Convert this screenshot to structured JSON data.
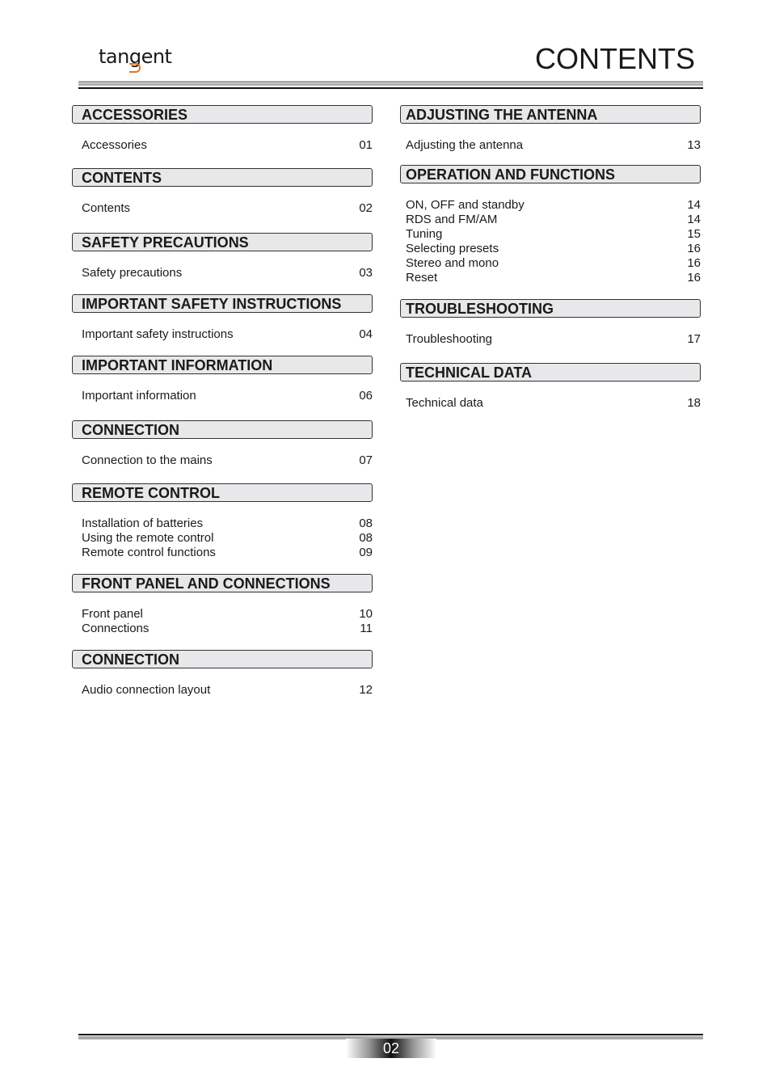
{
  "header": {
    "brand": "tangent",
    "title": "CONTENTS"
  },
  "footer": {
    "page_number": "02"
  },
  "left_column": [
    {
      "heading": "ACCESSORIES",
      "items": [
        {
          "label": "Accessories",
          "page": "01"
        }
      ]
    },
    {
      "heading": "CONTENTS",
      "items": [
        {
          "label": "Contents",
          "page": "02"
        }
      ]
    },
    {
      "heading": "SAFETY PRECAUTIONS",
      "items": [
        {
          "label": "Safety precautions",
          "page": "03"
        }
      ]
    },
    {
      "heading": "IMPORTANT SAFETY INSTRUCTIONS",
      "items": [
        {
          "label": "Important safety instructions",
          "page": "04"
        }
      ]
    },
    {
      "heading": "IMPORTANT INFORMATION",
      "items": [
        {
          "label": "Important information",
          "page": "06"
        }
      ]
    },
    {
      "heading": "CONNECTION",
      "items": [
        {
          "label": "Connection to the mains",
          "page": "07"
        }
      ]
    },
    {
      "heading": "REMOTE CONTROL",
      "items": [
        {
          "label": "Installation of batteries",
          "page": "08"
        },
        {
          "label": "Using the remote control",
          "page": "08"
        },
        {
          "label": "Remote control functions",
          "page": "09"
        }
      ]
    },
    {
      "heading": "FRONT PANEL AND CONNECTIONS",
      "items": [
        {
          "label": "Front panel",
          "page": "10"
        },
        {
          "label": "Connections",
          "page": "11"
        }
      ]
    },
    {
      "heading": "CONNECTION",
      "items": [
        {
          "label": "Audio connection layout",
          "page": "12"
        }
      ]
    }
  ],
  "right_column": [
    {
      "heading": "ADJUSTING THE ANTENNA",
      "items": [
        {
          "label": "Adjusting the antenna",
          "page": "13"
        }
      ]
    },
    {
      "heading": "OPERATION AND FUNCTIONS",
      "items": [
        {
          "label": "ON, OFF and standby",
          "page": "14"
        },
        {
          "label": "RDS and FM/AM",
          "page": "14"
        },
        {
          "label": "Tuning",
          "page": "15"
        },
        {
          "label": "Selecting presets",
          "page": "16"
        },
        {
          "label": "Stereo and mono",
          "page": "16"
        },
        {
          "label": "Reset",
          "page": "16"
        }
      ]
    },
    {
      "heading": "TROUBLESHOOTING",
      "items": [
        {
          "label": "Troubleshooting",
          "page": "17"
        }
      ]
    },
    {
      "heading": "TECHNICAL DATA",
      "items": [
        {
          "label": "Technical data",
          "page": "18"
        }
      ]
    }
  ],
  "colors": {
    "accent": "#e8731e",
    "heading_bg": "#e8e8ea"
  }
}
